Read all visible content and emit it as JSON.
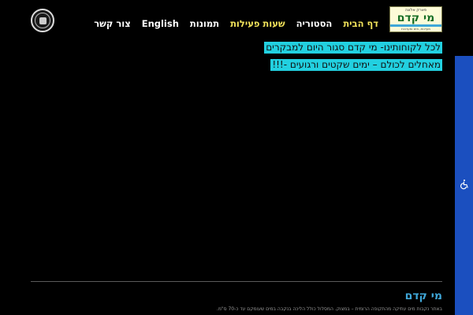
{
  "logo": {
    "top_text": "פארק אלונה",
    "main_text": "מי קדם",
    "sub_text": "מעיינות, מים ומערכות"
  },
  "nav": {
    "items": [
      {
        "label": "דף הבית",
        "highlight": true
      },
      {
        "label": "הסטוריה",
        "highlight": false
      },
      {
        "label": "שעות פעילות",
        "highlight": true
      },
      {
        "label": "תמונות",
        "highlight": false
      },
      {
        "label": "English",
        "highlight": false
      },
      {
        "label": "צור קשר",
        "highlight": false
      }
    ]
  },
  "banners": [
    "לכל לקוחותינו- מי קדם סגור היום למבקרים",
    "מאחלים לכולם – ימים שקטים ורגועים -!!!"
  ],
  "footer": {
    "title": "מי קדם",
    "text": "באתר נקבות מים עתיקה מהתקופה הרומית – במצוק. המסלול כולל הליכה בנקבה במים שעומקם עד כ-70 ס\"מ."
  },
  "colors": {
    "background": "#000000",
    "nav_highlight": "#f2e35b",
    "banner_bg": "#22d0e0",
    "accessibility_bar": "#1b4fbf",
    "footer_title": "#3fa7d8"
  },
  "icons": {
    "accessibility": "wheelchair-icon",
    "seal": "municipality-seal-icon"
  }
}
